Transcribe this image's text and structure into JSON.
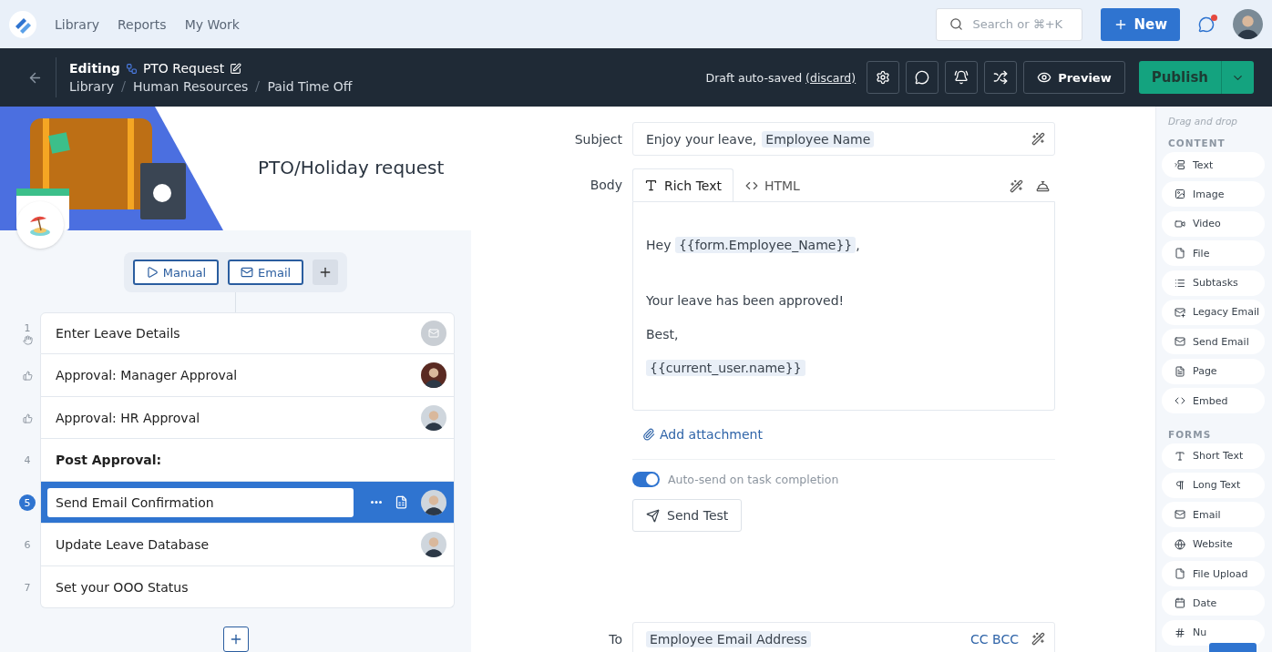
{
  "nav": {
    "links": [
      "Library",
      "Reports",
      "My Work"
    ],
    "search": {
      "placeholder": "Search or ⌘+K"
    },
    "new_button": "New",
    "messages_unread": true
  },
  "header": {
    "mode": "Editing",
    "title": "PTO Request",
    "breadcrumb": [
      "Library",
      "Human Resources",
      "Paid Time Off"
    ],
    "draft_status": "Draft auto-saved",
    "discard": "(discard)",
    "preview": "Preview",
    "publish": "Publish"
  },
  "workflow": {
    "title": "PTO/Holiday request",
    "triggers": [
      {
        "kind": "manual",
        "label": "Manual"
      },
      {
        "kind": "email",
        "label": "Email"
      }
    ],
    "tasks": [
      {
        "number": "1",
        "marker": {
          "kind": "hand"
        },
        "title": "Enter Leave Details",
        "heading": false,
        "selected": false,
        "assignee": {
          "kind": "email"
        }
      },
      {
        "marker": {
          "kind": "approval"
        },
        "title": "Approval: Manager Approval",
        "heading": false,
        "selected": false,
        "assignee": {
          "kind": "person"
        }
      },
      {
        "marker": {
          "kind": "approval"
        },
        "title": "Approval: HR Approval",
        "heading": false,
        "selected": false,
        "assignee": {
          "kind": "person"
        }
      },
      {
        "number": "4",
        "title": "Post Approval:",
        "heading": true,
        "selected": false
      },
      {
        "number": "5",
        "title": "Send Email Confirmation",
        "heading": false,
        "selected": true,
        "assignee": {
          "kind": "person"
        }
      },
      {
        "number": "6",
        "title": "Update Leave Database",
        "heading": false,
        "selected": false,
        "assignee": {
          "kind": "person"
        }
      },
      {
        "number": "7",
        "title": "Set your OOO Status",
        "heading": false,
        "selected": false
      }
    ]
  },
  "email": {
    "subject_label": "Subject",
    "subject_text": "Enjoy your leave,",
    "subject_token": "Employee Name",
    "body_label": "Body",
    "tabs": [
      {
        "kind": "rich",
        "label": "Rich Text",
        "selected": true
      },
      {
        "kind": "html",
        "label": "HTML",
        "selected": false
      }
    ],
    "body": [
      {
        "kind": "line",
        "text": "Hey",
        "token": "{{form.Employee_Name}}",
        "after": ","
      },
      {
        "kind": "blank"
      },
      {
        "kind": "line",
        "text": "Your leave has been approved!"
      },
      {
        "kind": "line",
        "text": "Best,"
      },
      {
        "kind": "line",
        "token": "{{current_user.name}}"
      }
    ],
    "attachment": "Add attachment",
    "auto_send": {
      "label": "Auto-send on task completion",
      "on": true
    },
    "send_test": "Send Test",
    "to_label": "To",
    "to_token": "Employee Email Address",
    "cc_bcc": "CC BCC"
  },
  "palette": {
    "hint": "Drag and drop",
    "sections": [
      {
        "title": "CONTENT",
        "items": [
          {
            "kind": "text",
            "label": "Text"
          },
          {
            "kind": "image",
            "label": "Image"
          },
          {
            "kind": "video",
            "label": "Video"
          },
          {
            "kind": "file",
            "label": "File"
          },
          {
            "kind": "subtasks",
            "label": "Subtasks"
          },
          {
            "kind": "legacy-email",
            "label": "Legacy Email"
          },
          {
            "kind": "send-email",
            "label": "Send Email"
          },
          {
            "kind": "page",
            "label": "Page"
          },
          {
            "kind": "embed",
            "label": "Embed"
          }
        ]
      },
      {
        "title": "FORMS",
        "items": [
          {
            "kind": "short-text",
            "label": "Short Text"
          },
          {
            "kind": "long-text",
            "label": "Long Text"
          },
          {
            "kind": "email",
            "label": "Email"
          },
          {
            "kind": "website",
            "label": "Website"
          },
          {
            "kind": "file-upload",
            "label": "File Upload"
          },
          {
            "kind": "date",
            "label": "Date"
          },
          {
            "kind": "number",
            "label": "Nu"
          }
        ]
      }
    ]
  }
}
